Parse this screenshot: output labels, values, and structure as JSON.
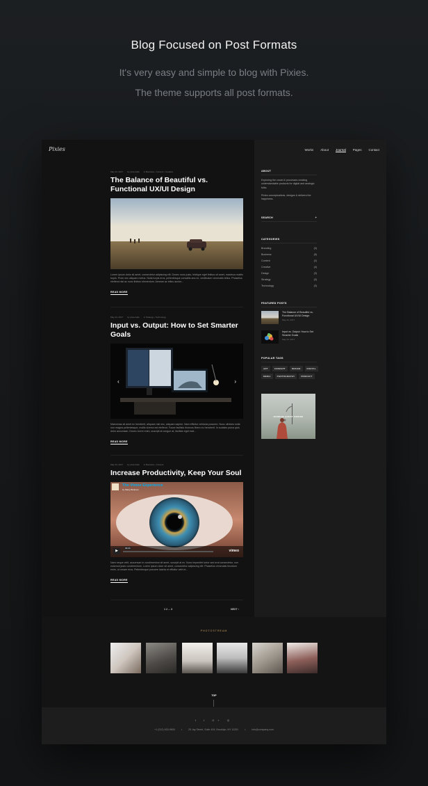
{
  "hero": {
    "title": "Blog Focused on Post Formats",
    "subtitle_line1": "It's very easy and simple to blog with Pixies.",
    "subtitle_line2": "The theme supports all post formats."
  },
  "site": {
    "logo": "Pixies",
    "nav": [
      "Works",
      "About",
      "Journal",
      "Pages",
      "Contact"
    ],
    "active_nav": "Journal"
  },
  "posts": [
    {
      "date": "May 24, 2017",
      "author": "by pixie-hallo",
      "categories": "in Business  •  Content  •  Creative",
      "title": "The Balance of Beautiful vs. Functional UX/UI Design",
      "excerpt": "Lorem ipsum dolor sit amet, consectetur adipiscing elit. Donec nunc justo, tristique eget finibus sit amet, maximus mattis turpis. Proin nec aliquam metus. Nulla turpis eros, pellentesque convallis arcu in, vestibulum venenatis tellus. Phasellus eleifend nisl ac nunc finibus elementum. Aenean ac tellus auctor...",
      "read_more": "READ MORE"
    },
    {
      "date": "May 24, 2017",
      "author": "by pixie-hallo",
      "categories": "in Strategy  •  Technology",
      "title": "Input vs. Output: How to Set Smarter Goals",
      "excerpt": "Maecenas sit amet ex hendrerit, aliquam nisl nec, aliquam sapien. Nam efficitur vehicula posuere. Nunc ultricies nulla non magna pellentesque, mollis viverra est eleifend. Fusce facilisis rhoncus libero eu hendrerit. In sodales purus quis dolor accumsan. Donec lorem enim, suscipit at congue at, facilisis eget erat...",
      "read_more": "READ MORE"
    },
    {
      "date": "May 24, 2017",
      "author": "by pixie-hallo",
      "categories": "in Business  •  Content",
      "title": "Increase Productivity, Keep Your Soul",
      "excerpt": "Nam neque velit, accumsan in condimentum sit amet, suscipit at ex. Nunc imperdiet tortor sed erat consectetur, non euismod justo condimentum. Lorem ipsum dolor sit amet, consectetur adipiscing elit. Phasellus venenatis tincidunt enim, ut ornare eros. Pellentesque posuere lacinia et efficitur velit et...",
      "read_more": "READ MORE",
      "video_title": "The Vimeo Experience",
      "video_by": "by Marty Birdman",
      "video_time": "02:24",
      "video_brand": "vimeo"
    }
  ],
  "pagination": {
    "pages": "1  2  ...  3",
    "next": "NEXT"
  },
  "sidebar": {
    "about_title": "ABOUT",
    "about_text1": "Exploring the crowd & processes creating understandable products for digital and analogic folks.",
    "about_text2": "Pixies conceptualizes, designs & delivers the happiness.",
    "search_label": "SEARCH",
    "categories_title": "CATEGORIES",
    "categories": [
      {
        "name": "Branding",
        "count": "(3)"
      },
      {
        "name": "Business",
        "count": "(5)"
      },
      {
        "name": "Content",
        "count": "(2)"
      },
      {
        "name": "Creative",
        "count": "(4)"
      },
      {
        "name": "Design",
        "count": "(3)"
      },
      {
        "name": "Strategy",
        "count": "(3)"
      },
      {
        "name": "Technology",
        "count": "(3)"
      }
    ],
    "featured_title": "FEATURED POSTS",
    "featured": [
      {
        "title": "The Balance of Beautiful vs. Functional UX/UI Design",
        "date": "May 24, 2017"
      },
      {
        "title": "Input vs. Output: How to Set Smarter Goals",
        "date": "May 24, 2017"
      }
    ],
    "tags_title": "POPULAR TAGS",
    "tags": [
      "ART",
      "CONCEPT",
      "DESIGN",
      "DIGITAL",
      "MEDIA",
      "PHOTOGRAPHY",
      "PRODUCT"
    ],
    "banner_text": "RANDOM QUEST ONSIDE"
  },
  "photostream": {
    "title": "PHOTOSTREAM"
  },
  "top_label": "TOP",
  "footer": {
    "social": "f   t   G+   ◎",
    "phone": "+1 (212) 633-9600",
    "address": "25 Jay Street, Suite 404, Brooklyn, NY 11201",
    "email": "info@company.com"
  }
}
